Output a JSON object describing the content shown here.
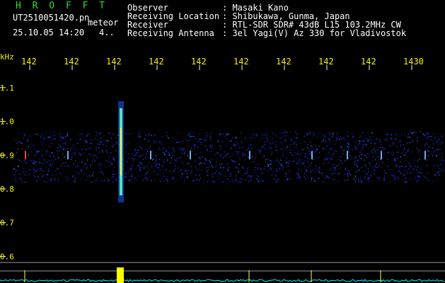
{
  "app": {
    "title": "H R O F F T",
    "filename": "UT2510051420.pn",
    "event_label": "meteor",
    "datetime": "25.10.05 14:20",
    "count": "4.."
  },
  "header": {
    "rows": [
      {
        "label": "Observer",
        "value": ": Masaki Kano"
      },
      {
        "label": "Receiving Location",
        "value": ": Shibukawa, Gunma, Japan"
      },
      {
        "label": "Receiver",
        "value": ": RTL-SDR SDR# 43dB L15 103.2MHz CW"
      },
      {
        "label": "Receiving Antenna",
        "value": ": 3el Yagi(V) Az 330 for Vladivostok"
      }
    ]
  },
  "chart_data": {
    "type": "heatmap",
    "y_unit_label": "kHz",
    "x_ticks": [
      "142",
      "142",
      "142",
      "142",
      "142",
      "142",
      "142",
      "142",
      "142",
      "1430"
    ],
    "y_ticks": [
      1.1,
      1.0,
      0.9,
      0.8,
      0.7,
      0.6
    ],
    "ylim": [
      0.58,
      1.15
    ],
    "signal_band": [
      0.82,
      0.97
    ],
    "carrier_line_khz": 0.9,
    "meteor_echo": {
      "x_tick_index": 2,
      "y_range": [
        0.76,
        1.06
      ]
    },
    "colors": {
      "axis_label": "#f4f400",
      "title": "#31d831",
      "noise": "#1a3cff",
      "echo": "#66ffcc",
      "spectrum": "#19e0ff"
    }
  }
}
